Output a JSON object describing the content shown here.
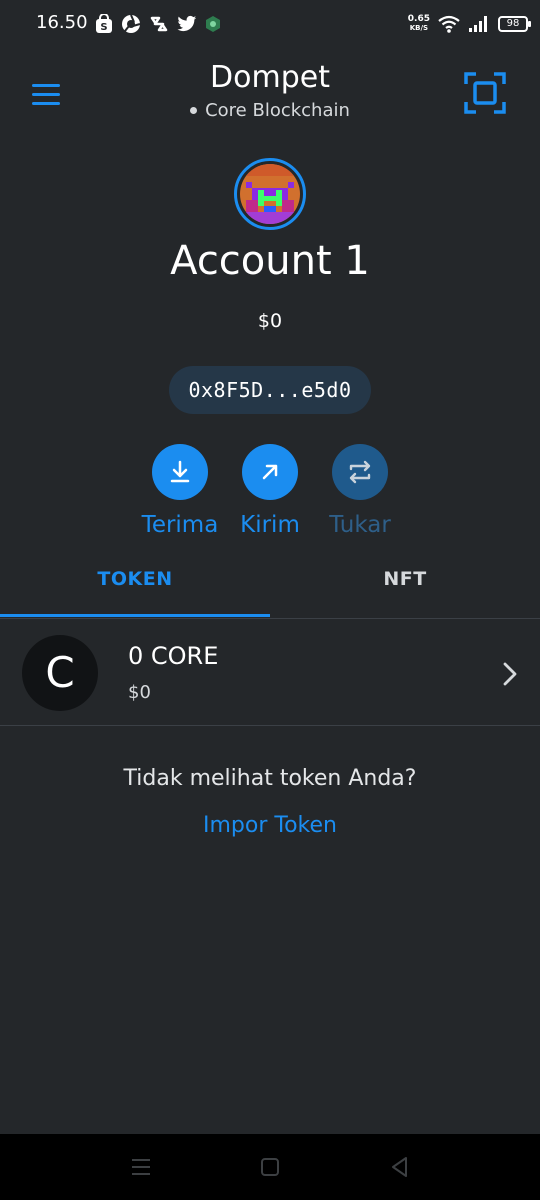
{
  "status_bar": {
    "time": "16.50",
    "net_speed_value": "0.65",
    "net_speed_unit": "KB/S",
    "battery": "98",
    "left_icons": [
      "shopee-icon",
      "app-icon",
      "app-icon",
      "twitter-icon",
      "shield-icon"
    ],
    "right_icons": [
      "wifi-icon",
      "signal-icon",
      "battery-icon"
    ]
  },
  "header": {
    "title": "Dompet",
    "network": "Core Blockchain",
    "menu_icon": "hamburger-menu-icon",
    "scan_icon": "scan-qr-icon"
  },
  "account": {
    "name": "Account 1",
    "balance": "$0",
    "address": "0x8F5D...e5d0"
  },
  "actions": [
    {
      "label": "Terima",
      "icon": "download-icon",
      "enabled": true
    },
    {
      "label": "Kirim",
      "icon": "arrow-up-right-icon",
      "enabled": true
    },
    {
      "label": "Tukar",
      "icon": "swap-icon",
      "enabled": false
    }
  ],
  "tabs": [
    {
      "label": "TOKEN",
      "active": true
    },
    {
      "label": "NFT",
      "active": false
    }
  ],
  "tokens": [
    {
      "symbol_letter": "C",
      "amount": "0 CORE",
      "fiat": "$0"
    }
  ],
  "empty_hint": {
    "text": "Tidak melihat token Anda?",
    "link": "Impor Token"
  },
  "colors": {
    "background": "#24272a",
    "accent": "#1b8df0",
    "pill": "#253748",
    "disabled": "#1f5a8c"
  }
}
